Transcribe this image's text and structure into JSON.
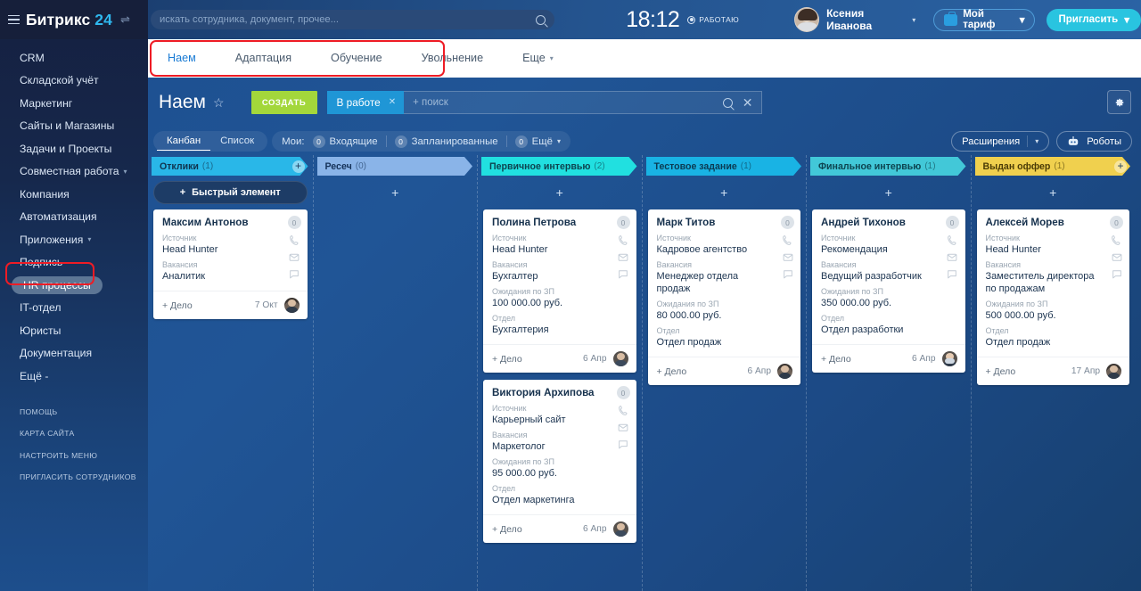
{
  "brand": {
    "name": "Битрикс",
    "num": "24"
  },
  "global_search": {
    "placeholder": "искать сотрудника, документ, прочее..."
  },
  "header": {
    "clock": "18:12",
    "work_status": "РАБОТАЮ",
    "user_name": "Ксения Иванова",
    "tariff_label": "Мой тариф",
    "invite_label": "Пригласить"
  },
  "sidebar": {
    "items": [
      {
        "label": "CRM",
        "chevron": false,
        "active": false
      },
      {
        "label": "Складской учёт",
        "chevron": false,
        "active": false
      },
      {
        "label": "Маркетинг",
        "chevron": false,
        "active": false
      },
      {
        "label": "Сайты и Магазины",
        "chevron": false,
        "active": false
      },
      {
        "label": "Задачи и Проекты",
        "chevron": false,
        "active": false
      },
      {
        "label": "Совместная работа",
        "chevron": true,
        "active": false
      },
      {
        "label": "Компания",
        "chevron": false,
        "active": false
      },
      {
        "label": "Автоматизация",
        "chevron": false,
        "active": false
      },
      {
        "label": "Приложения",
        "chevron": true,
        "active": false
      },
      {
        "label": "Подпись",
        "chevron": false,
        "active": false
      },
      {
        "label": "HR процессы",
        "chevron": false,
        "active": true
      },
      {
        "label": "IT-отдел",
        "chevron": false,
        "active": false
      },
      {
        "label": "Юристы",
        "chevron": false,
        "active": false
      },
      {
        "label": "Документация",
        "chevron": false,
        "active": false
      },
      {
        "label": "Ещё -",
        "chevron": false,
        "active": false
      }
    ],
    "footer": [
      "ПОМОЩЬ",
      "КАРТА САЙТА",
      "НАСТРОИТЬ МЕНЮ",
      "ПРИГЛАСИТЬ СОТРУДНИКОВ"
    ]
  },
  "tabs": [
    {
      "label": "Наем",
      "active": true
    },
    {
      "label": "Адаптация",
      "active": false
    },
    {
      "label": "Обучение",
      "active": false
    },
    {
      "label": "Увольнение",
      "active": false
    }
  ],
  "tabs_more": "Еще",
  "page": {
    "title": "Наем",
    "create_label": "СОЗДАТЬ",
    "filter_chip": "В работе",
    "filter_placeholder": "+ поиск"
  },
  "viewbar": {
    "kanban": "Канбан",
    "list": "Список",
    "my_label": "Мои:",
    "counters": [
      {
        "count": "0",
        "label": "Входящие"
      },
      {
        "count": "0",
        "label": "Запланированные"
      },
      {
        "count": "0",
        "label": "Ещё"
      }
    ],
    "extensions": "Расширения",
    "robots": "Роботы"
  },
  "columns": [
    {
      "name": "Отклики",
      "count": "(1)",
      "color": "#29b7e8",
      "text_color": "#10344f",
      "has_plus": true,
      "quick_element": "Быстрый элемент",
      "cards": [
        {
          "title": "Максим Антонов",
          "badge": "0",
          "fields": [
            {
              "label": "Источник",
              "value": "Head Hunter"
            },
            {
              "label": "Вакансия",
              "value": "Аналитик"
            }
          ],
          "deal": "+ Дело",
          "date": "7 Окт",
          "avatar": "a1"
        }
      ]
    },
    {
      "name": "Ресеч",
      "count": "(0)",
      "color": "#8ab4e8",
      "text_color": "#16335a",
      "has_plus": false,
      "quick_element": null,
      "cards": []
    },
    {
      "name": "Первичное интервью",
      "count": "(2)",
      "color": "#21e0e0",
      "text_color": "#0d4450",
      "has_plus": false,
      "quick_element": null,
      "cards": [
        {
          "title": "Полина Петрова",
          "badge": "0",
          "fields": [
            {
              "label": "Источник",
              "value": "Head Hunter"
            },
            {
              "label": "Вакансия",
              "value": "Бухгалтер"
            },
            {
              "label": "Ожидания по ЗП",
              "value": "100 000.00 руб."
            },
            {
              "label": "Отдел",
              "value": "Бухгалтерия"
            }
          ],
          "deal": "+ Дело",
          "date": "6 Апр",
          "avatar": "g"
        },
        {
          "title": "Виктория Архипова",
          "badge": "0",
          "fields": [
            {
              "label": "Источник",
              "value": "Карьерный сайт"
            },
            {
              "label": "Вакансия",
              "value": "Маркетолог"
            },
            {
              "label": "Ожидания по ЗП",
              "value": "95 000.00 руб."
            },
            {
              "label": "Отдел",
              "value": "Отдел маркетинга"
            }
          ],
          "deal": "+ Дело",
          "date": "6 Апр",
          "avatar": "g"
        }
      ]
    },
    {
      "name": "Тестовое задание",
      "count": "(1)",
      "color": "#19b3e4",
      "text_color": "#0b3b53",
      "has_plus": false,
      "quick_element": null,
      "cards": [
        {
          "title": "Марк Титов",
          "badge": "0",
          "fields": [
            {
              "label": "Источник",
              "value": "Кадровое агентство"
            },
            {
              "label": "Вакансия",
              "value": "Менеджер отдела продаж"
            },
            {
              "label": "Ожидания по ЗП",
              "value": "80 000.00 руб."
            },
            {
              "label": "Отдел",
              "value": "Отдел продаж"
            }
          ],
          "deal": "+ Дело",
          "date": "6 Апр",
          "avatar": "a1"
        }
      ]
    },
    {
      "name": "Финальное интервью",
      "count": "(1)",
      "color": "#42c8d8",
      "text_color": "#0d4450",
      "has_plus": false,
      "quick_element": null,
      "cards": [
        {
          "title": "Андрей Тихонов",
          "badge": "0",
          "fields": [
            {
              "label": "Источник",
              "value": "Рекомендация"
            },
            {
              "label": "Вакансия",
              "value": "Ведущий разработчик"
            },
            {
              "label": "Ожидания по ЗП",
              "value": "350 000.00 руб."
            },
            {
              "label": "Отдел",
              "value": "Отдел разработки"
            }
          ],
          "deal": "+ Дело",
          "date": "6 Апр",
          "avatar": "m"
        }
      ]
    },
    {
      "name": "Выдан оффер",
      "count": "(1)",
      "color": "#f0d04e",
      "text_color": "#4b3c06",
      "has_plus": true,
      "quick_element": null,
      "cards": [
        {
          "title": "Алексей Морев",
          "badge": "0",
          "fields": [
            {
              "label": "Источник",
              "value": "Head Hunter"
            },
            {
              "label": "Вакансия",
              "value": "Заместитель директора по продажам"
            },
            {
              "label": "Ожидания по ЗП",
              "value": "500 000.00 руб."
            },
            {
              "label": "Отдел",
              "value": "Отдел продаж"
            }
          ],
          "deal": "+ Дело",
          "date": "17 Апр",
          "avatar": "a1"
        }
      ]
    }
  ]
}
